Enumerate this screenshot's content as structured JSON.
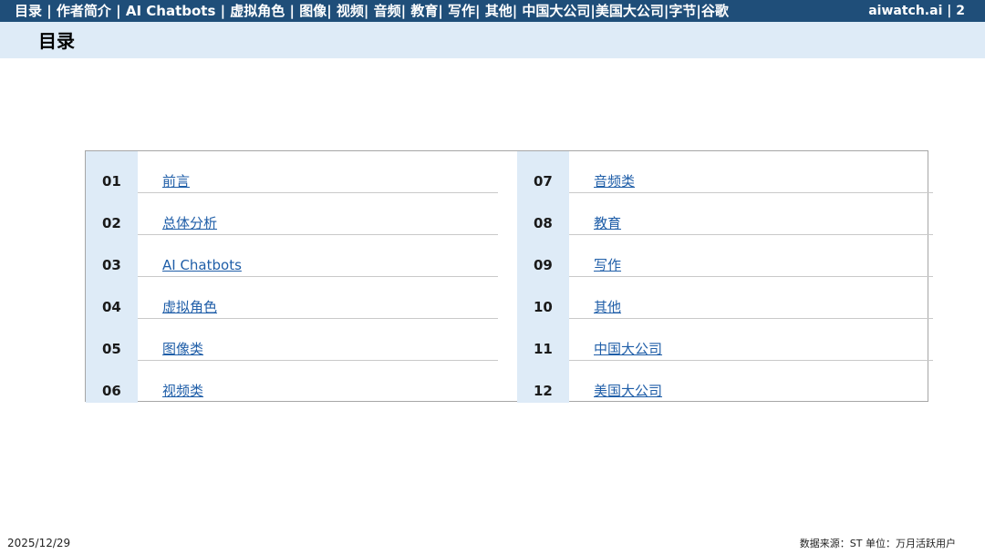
{
  "header": {
    "nav": "目录 | 作者简介 | AI Chatbots | 虚拟角色 | 图像| 视频| 音频| 教育| 写作| 其他| 中国大公司|美国大公司|字节|谷歌",
    "brand": "aiwatch.ai",
    "page_number": "2"
  },
  "title": "目录",
  "toc": {
    "left": [
      {
        "num": "01",
        "label": "前言"
      },
      {
        "num": "02",
        "label": "总体分析"
      },
      {
        "num": "03",
        "label": "AI Chatbots"
      },
      {
        "num": "04",
        "label": "虚拟角色"
      },
      {
        "num": "05",
        "label": "图像类"
      },
      {
        "num": "06",
        "label": "视频类"
      }
    ],
    "right": [
      {
        "num": "07",
        "label": "音频类"
      },
      {
        "num": "08",
        "label": "教育"
      },
      {
        "num": "09",
        "label": "写作"
      },
      {
        "num": "10",
        "label": "其他"
      },
      {
        "num": "11",
        "label": "中国大公司"
      },
      {
        "num": "12",
        "label": "美国大公司"
      }
    ]
  },
  "footer": {
    "date": "2025/12/29",
    "source": "数据来源：ST  单位：万月活跃用户"
  },
  "colors": {
    "topbar": "#1f4e79",
    "titlebar": "#deebf7",
    "link": "#1f5ea8"
  }
}
